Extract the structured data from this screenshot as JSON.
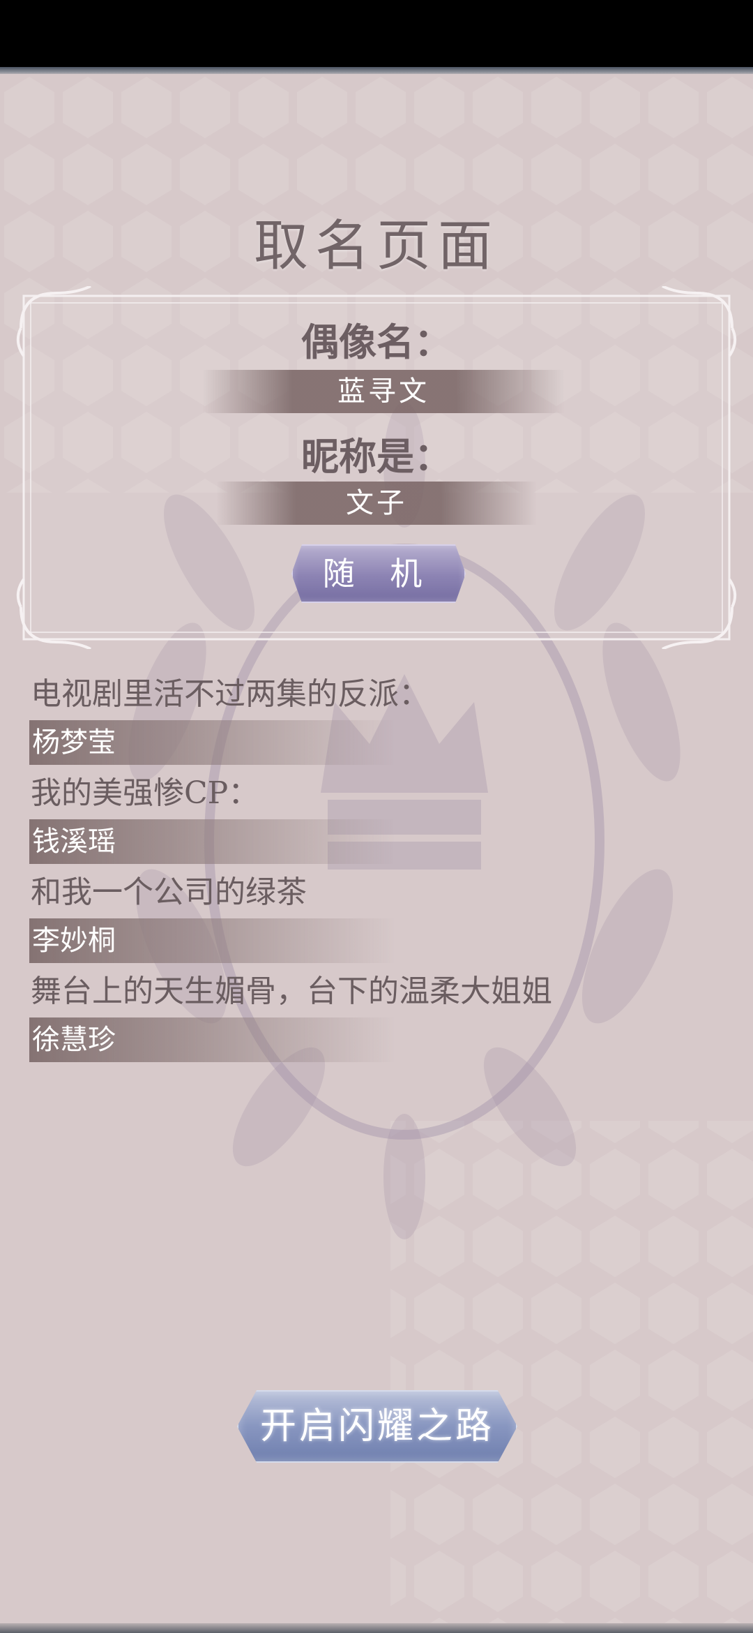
{
  "page": {
    "title": "取名页面"
  },
  "idol": {
    "name_label": "偶像名：",
    "name_value": "蓝寻文",
    "nickname_label": "昵称是：",
    "nickname_value": "文子",
    "random_button": "随 机"
  },
  "roles": [
    {
      "description": "电视剧里活不过两集的反派：",
      "name": "杨梦莹"
    },
    {
      "description": "我的美强惨CP：",
      "name": "钱溪瑶"
    },
    {
      "description": "和我一个公司的绿茶",
      "name": "李妙桐"
    },
    {
      "description": "舞台上的天生媚骨，台下的温柔大姐姐",
      "name": "徐慧珍"
    }
  ],
  "footer": {
    "start_button": "开启闪耀之路"
  },
  "colors": {
    "background": "#d7c9ca",
    "text": "#6a5d60",
    "random_button": "#8c83b3",
    "start_button": "#8896c0"
  }
}
